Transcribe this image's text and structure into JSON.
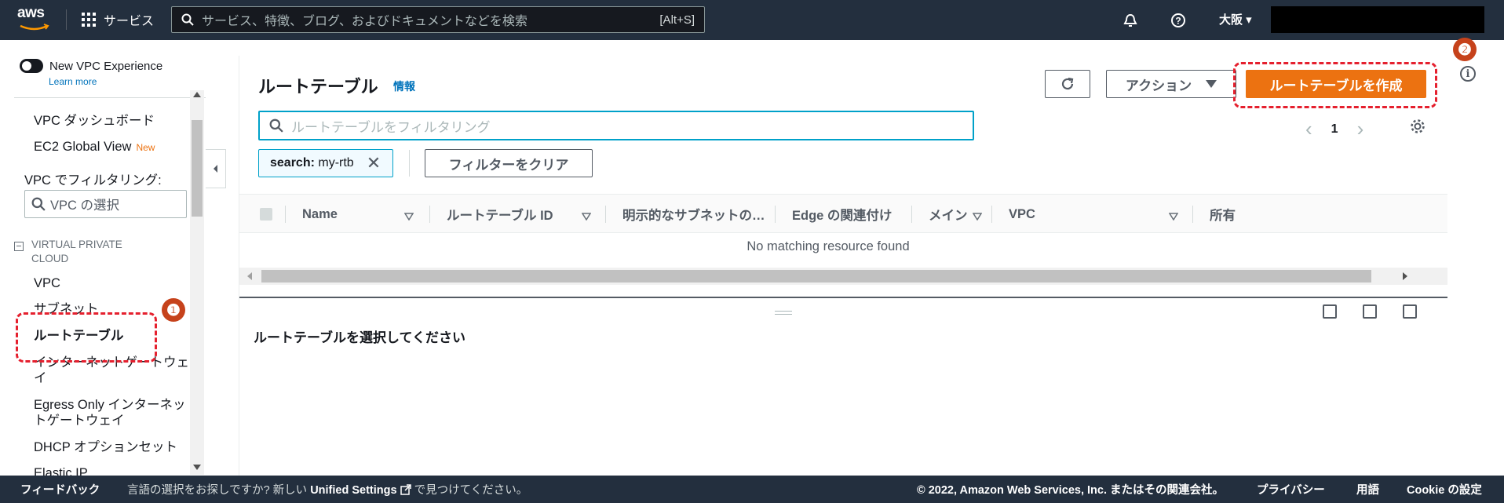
{
  "topnav": {
    "logo_text": "aws",
    "services_label": "サービス",
    "search_placeholder": "サービス、特徴、ブログ、およびドキュメントなどを検索",
    "search_shortcut": "[Alt+S]",
    "region": "大阪 ▾",
    "icons": [
      "bell-icon",
      "help-icon"
    ],
    "colors": {
      "bg": "#232f3e",
      "accent": "#ec7211"
    }
  },
  "sidebar": {
    "toggle_label": "New VPC Experience",
    "learn_more": "Learn more",
    "items_top": [
      {
        "label": "VPC ダッシュボード"
      },
      {
        "label": "EC2 Global View",
        "badge": "New"
      }
    ],
    "filter_label": "VPC でフィルタリング:",
    "filter_placeholder": "VPC の選択",
    "section_title": "VIRTUAL PRIVATE CLOUD",
    "items": [
      {
        "label": "VPC"
      },
      {
        "label": "サブネット"
      },
      {
        "label": "ルートテーブル",
        "selected": true
      },
      {
        "label": "インターネットゲートウェイ"
      },
      {
        "label": "Egress Only インターネットゲートウェイ"
      },
      {
        "label": "DHCP オプションセット"
      },
      {
        "label": "Elastic IP"
      }
    ]
  },
  "annotations": {
    "badge1": "❶",
    "badge2": "❷",
    "color": "#e5202e"
  },
  "main": {
    "title": "ルートテーブル",
    "info_link": "情報",
    "actions_label": "アクション",
    "create_label": "ルートテーブルを作成",
    "filter_placeholder": "ルートテーブルをフィルタリング",
    "pager": {
      "prev": "‹",
      "page": "1",
      "next": "›"
    },
    "token": {
      "key": "search:",
      "value": "my-rtb",
      "remove": "✕"
    },
    "clear_filter_label": "フィルターをクリア",
    "columns": [
      "Name",
      "ルートテーブル ID",
      "明示的なサブネットの…",
      "Edge の関連付け",
      "メイン",
      "VPC",
      "所有"
    ],
    "empty_message": "No matching resource found",
    "detail_message": "ルートテーブルを選択してください"
  },
  "footer": {
    "feedback": "フィードバック",
    "lang_prefix": "言語の選択をお探しですか? 新しい",
    "lang_link": "Unified Settings",
    "lang_suffix": "で見つけてください。",
    "copyright": "© 2022, Amazon Web Services, Inc. またはその関連会社。",
    "privacy": "プライバシー",
    "terms": "用語",
    "cookie": "Cookie の設定"
  }
}
